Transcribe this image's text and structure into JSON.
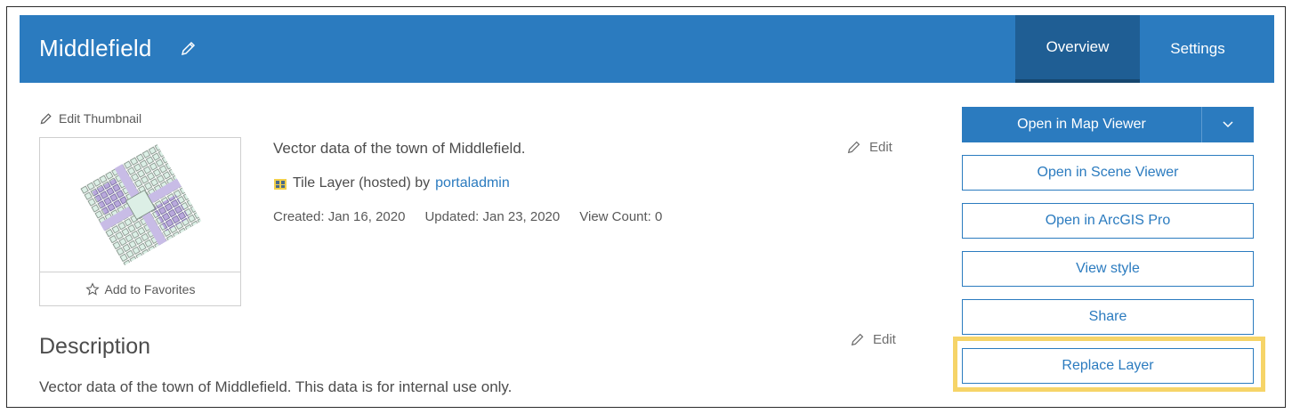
{
  "header": {
    "title": "Middlefield",
    "tabs": [
      {
        "label": "Overview",
        "active": true
      },
      {
        "label": "Settings",
        "active": false
      }
    ],
    "color": "#2b7bbf"
  },
  "thumbnail": {
    "edit_label": "Edit Thumbnail",
    "favorites_label": "Add to Favorites"
  },
  "item": {
    "summary": "Vector data of the town of Middlefield.",
    "type_label": "Tile Layer (hosted) by",
    "owner": "portaladmin",
    "created": "Created: Jan 16, 2020",
    "updated": "Updated: Jan 23, 2020",
    "view_count": "View Count: 0",
    "edit_label": "Edit"
  },
  "description": {
    "heading": "Description",
    "text": "Vector data of the town of Middlefield.  This data is for internal use only.",
    "edit_label": "Edit"
  },
  "actions": {
    "open_map_viewer": "Open in Map Viewer",
    "open_scene_viewer": "Open in Scene Viewer",
    "open_arcgis_pro": "Open in ArcGIS Pro",
    "view_style": "View style",
    "share": "Share",
    "replace_layer": "Replace Layer",
    "highlight_color": "#f6d468"
  }
}
